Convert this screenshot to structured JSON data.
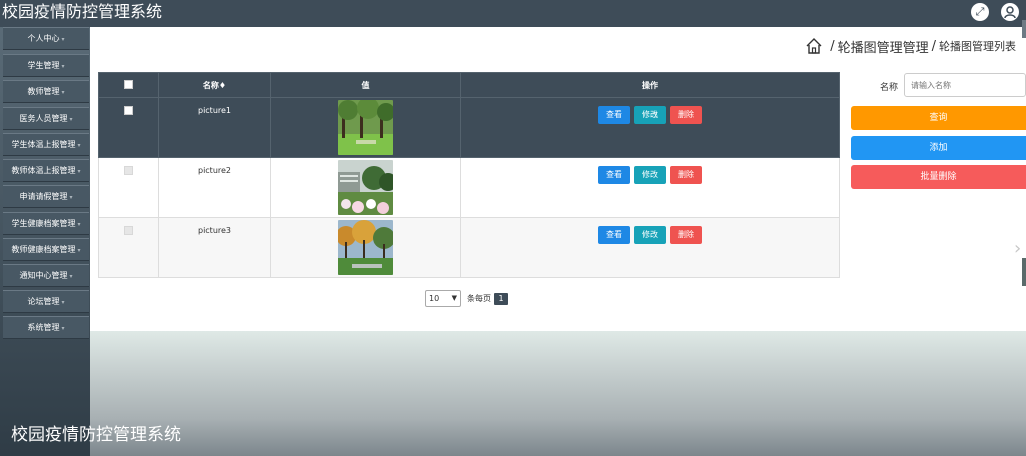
{
  "header": {
    "title": "校园疫情防控管理系统",
    "fullscreen_icon": "expand-arrows-icon",
    "user_icon": "user-avatar-icon"
  },
  "sidebar": {
    "items": [
      {
        "label": "个人中心"
      },
      {
        "label": "学生管理"
      },
      {
        "label": "教师管理"
      },
      {
        "label": "医务人员管理"
      },
      {
        "label": "学生体温上报管理"
      },
      {
        "label": "教师体温上报管理"
      },
      {
        "label": "申请请假管理"
      },
      {
        "label": "学生健康档案管理"
      },
      {
        "label": "教师健康档案管理"
      },
      {
        "label": "通知中心管理"
      },
      {
        "label": "论坛管理"
      },
      {
        "label": "系统管理"
      }
    ]
  },
  "breadcrumb": {
    "home_icon": "home-icon",
    "section": "轮播图管理管理",
    "separator": "/",
    "page": "轮播图管理列表"
  },
  "table": {
    "headers": {
      "name": "名称",
      "sort_mark": "♦",
      "value": "值",
      "actions": "操作"
    },
    "rows": [
      {
        "name": "picture1",
        "selected": true
      },
      {
        "name": "picture2",
        "selected": false
      },
      {
        "name": "picture3",
        "selected": false
      }
    ],
    "buttons": {
      "view": "查看",
      "edit": "修改",
      "delete": "删除"
    }
  },
  "pagination": {
    "page_size": "10",
    "page_size_label": "条每页",
    "current_page": "1"
  },
  "search": {
    "label": "名称",
    "placeholder": "请输入名称"
  },
  "actions": {
    "query": "查询",
    "add": "添加",
    "batch_delete": "批量删除"
  },
  "footer": {
    "text": "校园疫情防控管理系统"
  },
  "colors": {
    "header_bg": "#3e4c58",
    "view": "#1e88e5",
    "edit": "#17a2b8",
    "delete": "#ef5350",
    "query": "#ff9800",
    "add": "#2196f3",
    "batch_delete": "#f65b5b"
  }
}
